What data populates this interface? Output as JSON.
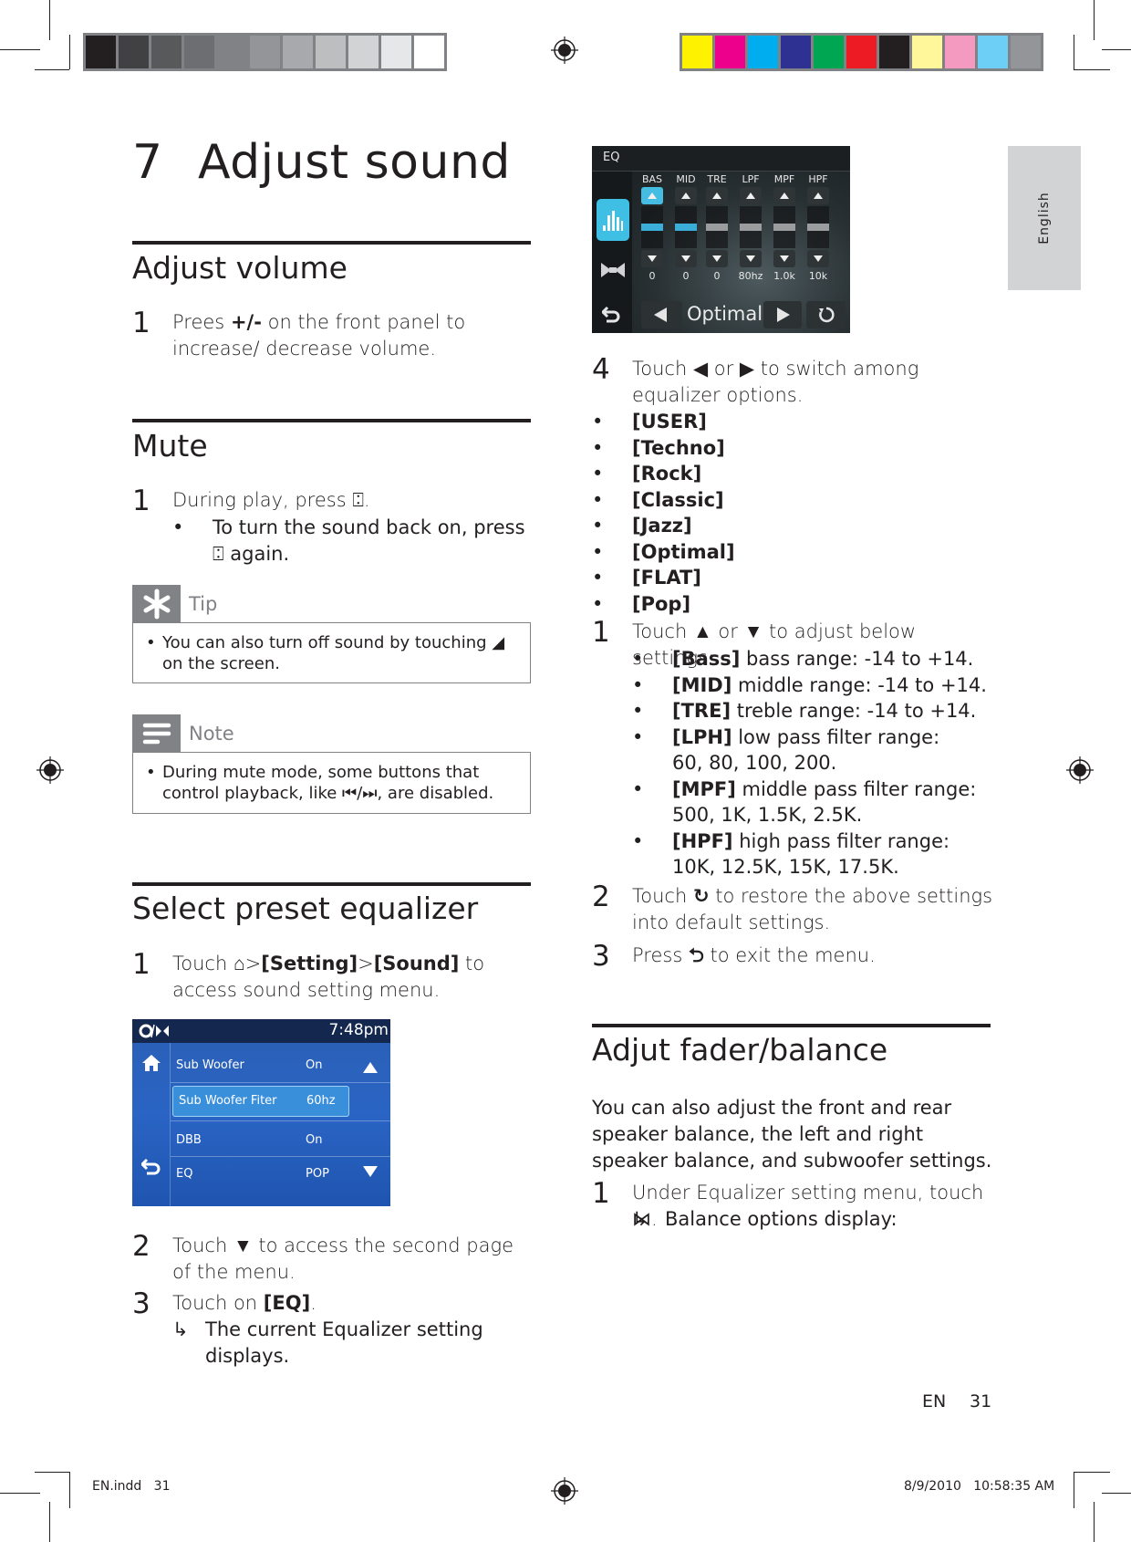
{
  "print_marks": {
    "grayscale_swatches": [
      "#231f20",
      "#414042",
      "#58595b",
      "#6d6e71",
      "#808285",
      "#939598",
      "#a7a9ac",
      "#bcbec0",
      "#d1d3d4",
      "#e6e7e8",
      "#ffffff"
    ],
    "color_swatches": [
      "#fff200",
      "#ec008c",
      "#00aeef",
      "#2e3192",
      "#00a651",
      "#ed1c24",
      "#231f20",
      "#fff799",
      "#f49ac1",
      "#6dcff6",
      "#939598"
    ]
  },
  "language_tab": "English",
  "chapter": {
    "number": "7",
    "title": "Adjust sound"
  },
  "sections": {
    "adjust_volume": {
      "heading": "Adjust volume",
      "steps": [
        {
          "n": "1",
          "pre": "Prees ",
          "bold": "+/-",
          "post": " on the front panel to increase/ decrease volume."
        }
      ]
    },
    "mute": {
      "heading": "Mute",
      "steps": [
        {
          "n": "1",
          "text": "During play, press ⍠."
        }
      ],
      "bullets": [
        "To turn the sound back on, press ⍠ again."
      ],
      "tip": {
        "label": "Tip",
        "icon": "asterisk-icon",
        "text": "You can also turn off sound by touching ◢ on the screen."
      },
      "note": {
        "label": "Note",
        "icon": "note-lines-icon",
        "text": "During mute mode, some buttons that control playback, like ⏮/⏭, are disabled."
      }
    },
    "select_preset": {
      "heading": "Select preset equalizer",
      "step1": {
        "n": "1",
        "pre": "Touch ",
        "icon": "home-icon",
        "b1": "[Setting]",
        "sep": ">",
        "b2": "[Sound]",
        "post": " to access sound setting menu."
      },
      "step2": {
        "n": "2",
        "text": "Touch ▼ to access the second page of the menu."
      },
      "step3": {
        "n": "3",
        "pre": "Touch on ",
        "bold": "[EQ]",
        "post": "."
      },
      "step3_result": "The current Equalizer setting displays."
    },
    "eq_options": {
      "step4": {
        "n": "4",
        "text": "Touch ◀ or ▶ to switch among equalizer options."
      },
      "options": [
        "[USER]",
        "[Techno]",
        "[Rock]",
        "[Classic]",
        "[Jazz]",
        "[Optimal]",
        "[FLAT]",
        "[Pop]"
      ],
      "adjust_step": {
        "n": "1",
        "text": "Touch ▲ or ▼ to adjust below settings:"
      },
      "settings": [
        {
          "key": "[Bass]",
          "desc": " bass range: -14 to +14."
        },
        {
          "key": "[MID]",
          "desc": " middle range: -14 to +14."
        },
        {
          "key": "[TRE]",
          "desc": " treble range: -14 to +14."
        },
        {
          "key": "[LPH]",
          "desc": " low pass filter range:",
          "line2": "60, 80, 100, 200."
        },
        {
          "key": "[MPF]",
          "desc": " middle pass filter range:",
          "line2": "500, 1K, 1.5K, 2.5K."
        },
        {
          "key": "[HPF]",
          "desc": " high pass filter range:",
          "line2": "10K, 12.5K, 15K, 17.5K."
        }
      ],
      "restore_step": {
        "n": "2",
        "pre": "Touch ",
        "icon": "↻",
        "post": " to restore the above settings into default settings."
      },
      "exit_step": {
        "n": "3",
        "pre": "Press ",
        "icon": "⮌",
        "post": " to exit the menu."
      }
    },
    "fader": {
      "heading": "Adjut fader/balance",
      "intro": "You can also adjust the front and rear speaker balance, the left and right speaker balance, and subwoofer settings.",
      "step1": {
        "n": "1",
        "text": "Under Equalizer setting menu, touch ⋈."
      },
      "step1_result": "Balance options display:"
    }
  },
  "eq_screen": {
    "title": "EQ",
    "bands": [
      {
        "label": "BAS",
        "value": "0",
        "active": true
      },
      {
        "label": "MID",
        "value": "0",
        "active": false
      },
      {
        "label": "TRE",
        "value": "0",
        "active": false
      },
      {
        "label": "LPF",
        "value": "80hz",
        "active": false
      },
      {
        "label": "MPF",
        "value": "1.0k",
        "active": false
      },
      {
        "label": "HPF",
        "value": "10k",
        "active": false
      }
    ],
    "preset": "Optimal",
    "accent": "#3fbfe4"
  },
  "settings_screen": {
    "clock": "7:48pm",
    "rows": [
      {
        "key": "Sub Woofer",
        "value": "On"
      },
      {
        "key": "Sub Woofer Fiter",
        "value": "60hz"
      },
      {
        "key": "DBB",
        "value": "On"
      },
      {
        "key": "EQ",
        "value": "POP"
      }
    ]
  },
  "footer": {
    "lang": "EN",
    "page": "31",
    "file": "EN.indd   31",
    "timestamp": "8/9/2010   10:58:35 AM"
  }
}
